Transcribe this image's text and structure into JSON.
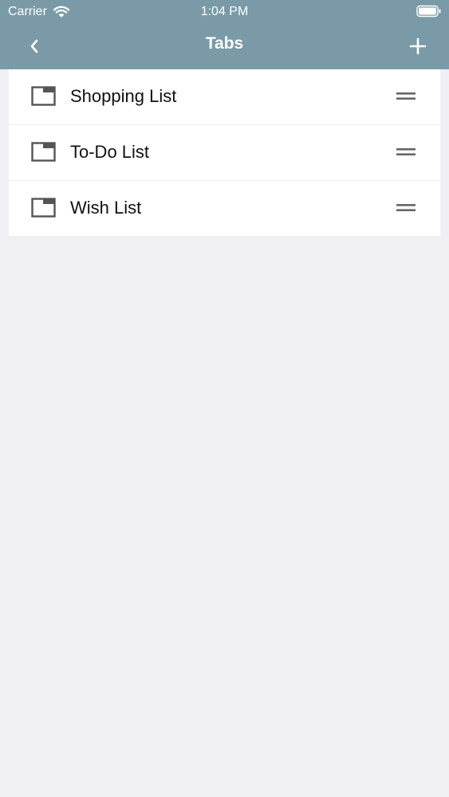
{
  "status_bar": {
    "carrier": "Carrier",
    "time": "1:04 PM"
  },
  "nav": {
    "title": "Tabs",
    "back_icon": "chevron-left-icon",
    "add_icon": "plus-icon"
  },
  "tabs": [
    {
      "label": "Shopping List",
      "icon": "tab-icon"
    },
    {
      "label": "To-Do List",
      "icon": "tab-icon"
    },
    {
      "label": "Wish List",
      "icon": "tab-icon"
    }
  ],
  "colors": {
    "header": "#7b9aa7",
    "background": "#f0eff4",
    "row": "#ffffff",
    "icon": "#555555"
  }
}
